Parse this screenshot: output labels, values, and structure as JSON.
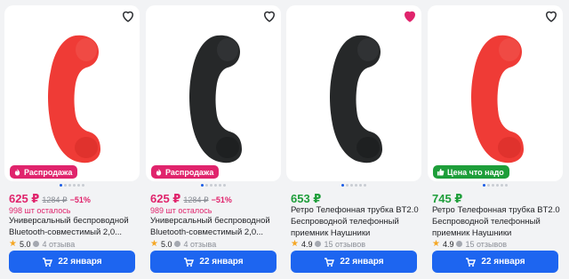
{
  "colors": {
    "price_sale": "#e0246c",
    "price_good": "#1e9e3a",
    "badge_sale": "#e0246c",
    "badge_good": "#1e9e3a",
    "button": "#1d65f0",
    "phone_red": "#ef3b36",
    "phone_black": "#262829"
  },
  "products": [
    {
      "phone_color": "red",
      "favorite": false,
      "badge": "Распродажа",
      "badge_type": "sale",
      "price": "625 ₽",
      "old_price": "1284 ₽",
      "discount": "−51%",
      "stock": "998 шт осталось",
      "title_line1": "Универсальный беспроводной",
      "title_line2": "Bluetooth-совместимый 2,0...",
      "rating": "5.0",
      "reviews": "4 отзыва",
      "delivery": "22 января"
    },
    {
      "phone_color": "black",
      "favorite": false,
      "badge": "Распродажа",
      "badge_type": "sale",
      "price": "625 ₽",
      "old_price": "1284 ₽",
      "discount": "−51%",
      "stock": "989 шт осталось",
      "title_line1": "Универсальный беспроводной",
      "title_line2": "Bluetooth-совместимый 2,0...",
      "rating": "5.0",
      "reviews": "4 отзыва",
      "delivery": "22 января"
    },
    {
      "phone_color": "black",
      "favorite": true,
      "badge": "",
      "badge_type": "none",
      "price": "653 ₽",
      "old_price": "",
      "discount": "",
      "stock": "",
      "title_line1": "Ретро Телефонная трубка BT2.0",
      "title_line2": "Беспроводной телефонный",
      "title_line3": "приемник Наушники",
      "rating": "4.9",
      "reviews": "15 отзывов",
      "delivery": "22 января"
    },
    {
      "phone_color": "red",
      "favorite": false,
      "badge": "Цена что надо",
      "badge_type": "good",
      "price": "745 ₽",
      "old_price": "",
      "discount": "",
      "stock": "",
      "title_line1": "Ретро Телефонная трубка BT2.0",
      "title_line2": "Беспроводной телефонный",
      "title_line3": "приемник Наушники",
      "rating": "4.9",
      "reviews": "15 отзывов",
      "delivery": "22 января"
    }
  ]
}
